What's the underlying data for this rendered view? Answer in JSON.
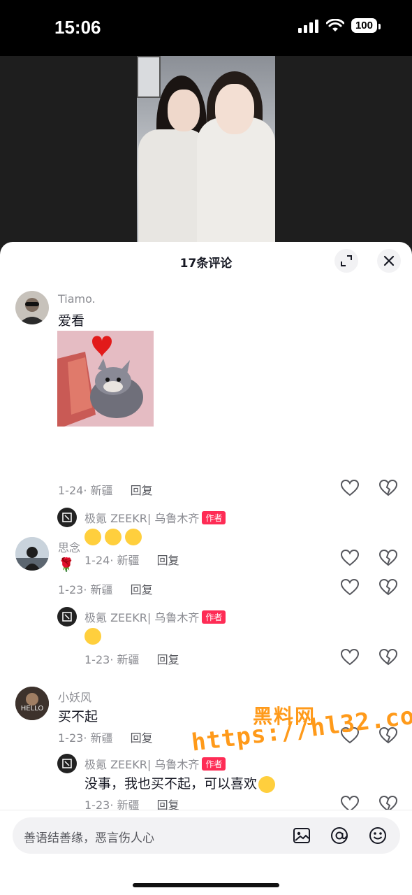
{
  "status_bar": {
    "time": "15:06",
    "battery": "100"
  },
  "sheet": {
    "title": "17条评论"
  },
  "comments": [
    {
      "username": "Tiamo.",
      "text": "爱看",
      "date": "1-24",
      "location": "新疆",
      "reply_label": "回复",
      "reply": {
        "username": "极氪 ZEEKR| 乌鲁木齐",
        "badge": "作者",
        "date": "1-24",
        "location": "新疆",
        "reply_label": "回复"
      }
    },
    {
      "username": "思念",
      "text": "🌹",
      "date": "1-23",
      "location": "新疆",
      "reply_label": "回复",
      "reply": {
        "username": "极氪 ZEEKR| 乌鲁木齐",
        "badge": "作者",
        "date": "1-23",
        "location": "新疆",
        "reply_label": "回复"
      }
    },
    {
      "username": "小妖风",
      "text": "买不起",
      "date": "1-23",
      "location": "新疆",
      "reply_label": "回复",
      "reply": {
        "username": "极氪 ZEEKR| 乌鲁木齐",
        "badge": "作者",
        "text": "没事，我也买不起，可以喜欢",
        "date": "1-23",
        "location": "新疆",
        "reply_label": "回复"
      }
    }
  ],
  "watermark": {
    "top": "黑料网",
    "url": "https://hl32.co"
  },
  "input": {
    "placeholder": "善语结善缘，恶言伤人心"
  },
  "colors": {
    "author_badge": "#fe2c55",
    "meta": "#8a8b91",
    "text": "#161823",
    "watermark": "#ff9a1a"
  }
}
